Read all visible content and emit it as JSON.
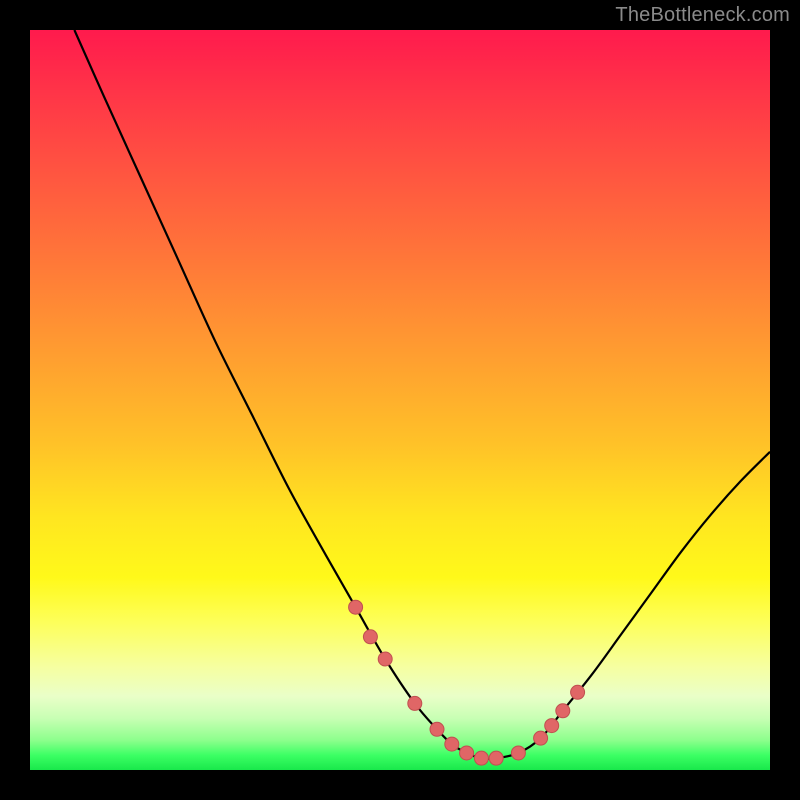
{
  "watermark": "TheBottleneck.com",
  "colors": {
    "background": "#000000",
    "curve_stroke": "#000000",
    "dot_fill": "#e06666",
    "dot_stroke": "#c05050"
  },
  "chart_data": {
    "type": "line",
    "title": "",
    "xlabel": "",
    "ylabel": "",
    "xlim": [
      0,
      100
    ],
    "ylim": [
      0,
      100
    ],
    "grid": false,
    "series": [
      {
        "name": "bottleneck-curve",
        "x": [
          6,
          10,
          15,
          20,
          25,
          30,
          35,
          40,
          44,
          48,
          52,
          55,
          57,
          59,
          61,
          63,
          66,
          69,
          72,
          76,
          80,
          84,
          88,
          92,
          96,
          100
        ],
        "y": [
          100,
          91,
          80,
          69,
          58,
          48,
          38,
          29,
          22,
          15,
          9,
          5.5,
          3.5,
          2.3,
          1.6,
          1.6,
          2.3,
          4.3,
          8,
          13,
          18.5,
          24,
          29.5,
          34.5,
          39,
          43
        ]
      }
    ],
    "dots": {
      "name": "highlight-dots",
      "x": [
        44,
        46,
        48,
        52,
        55,
        57,
        59,
        61,
        63,
        66,
        69,
        70.5,
        72,
        74
      ],
      "y": [
        22,
        18,
        15,
        9,
        5.5,
        3.5,
        2.3,
        1.6,
        1.6,
        2.3,
        4.3,
        6,
        8,
        10.5
      ]
    }
  }
}
